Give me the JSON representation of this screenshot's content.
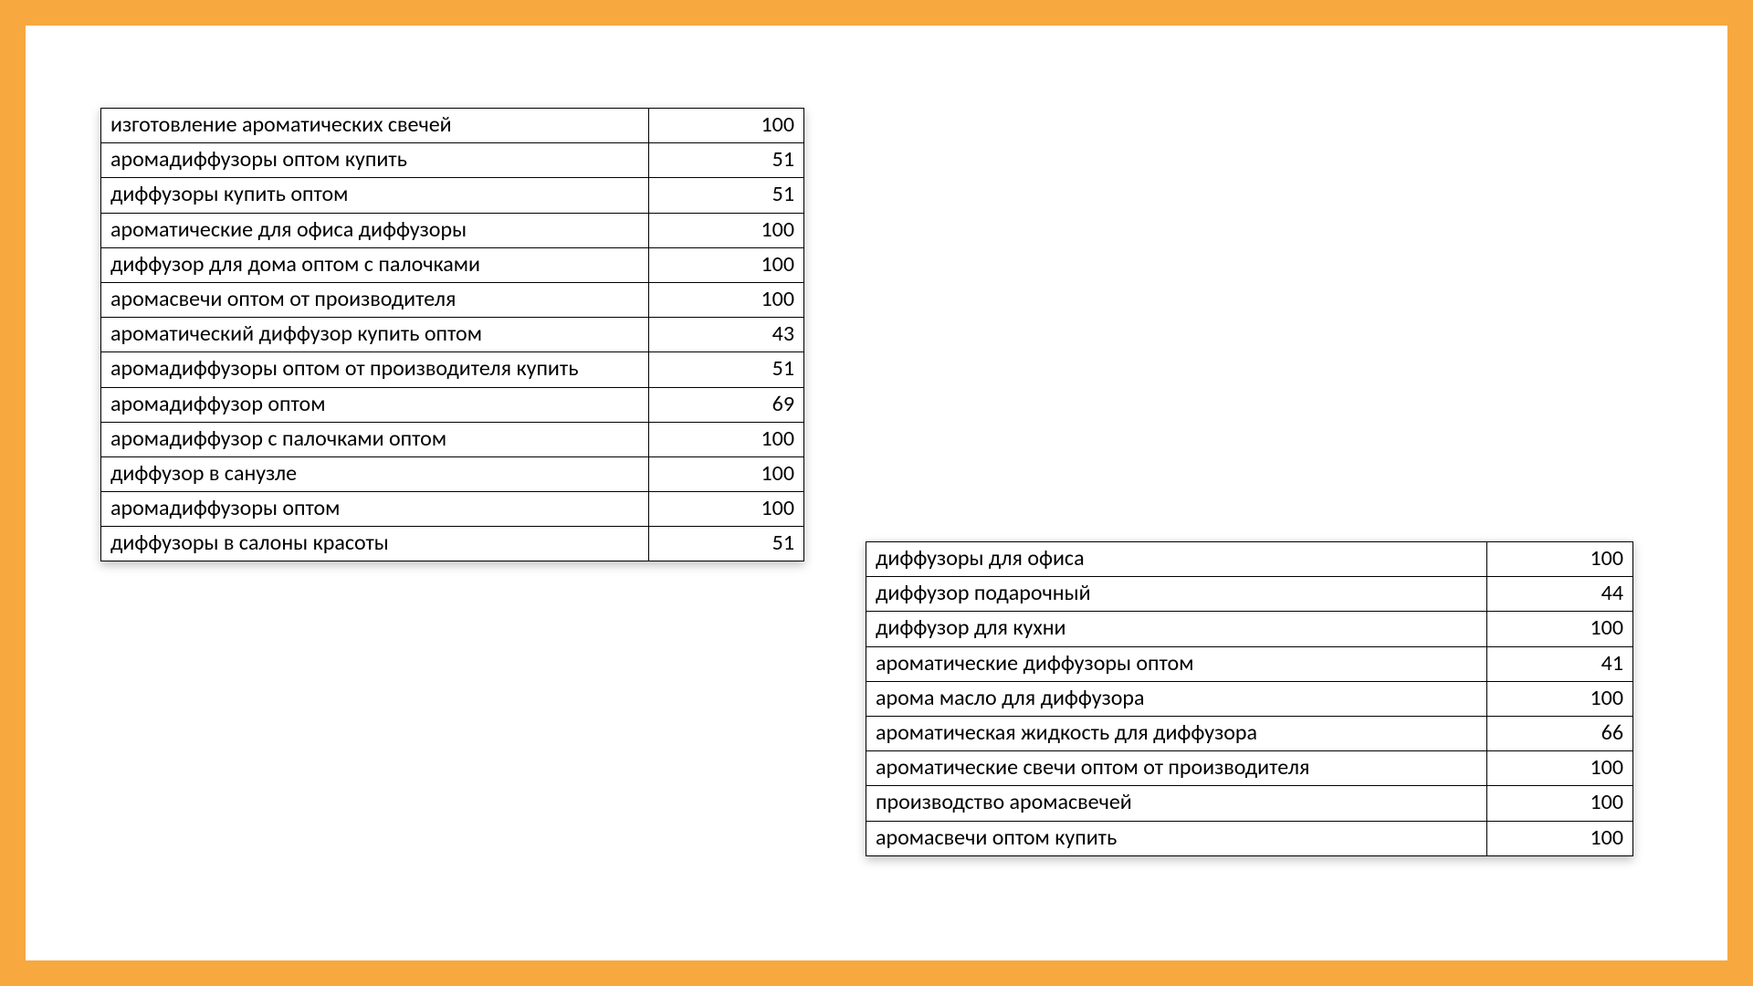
{
  "frame_color": "#f7a83f",
  "tables": {
    "left": {
      "rows": [
        {
          "term": "изготовление ароматических свечей",
          "value": 100
        },
        {
          "term": "аромадиффузоры оптом купить",
          "value": 51
        },
        {
          "term": "диффузоры купить оптом",
          "value": 51
        },
        {
          "term": "ароматические для офиса диффузоры",
          "value": 100
        },
        {
          "term": "диффузор для дома оптом с палочками",
          "value": 100
        },
        {
          "term": "аромасвечи оптом от производителя",
          "value": 100
        },
        {
          "term": "ароматический диффузор купить оптом",
          "value": 43
        },
        {
          "term": "аромадиффузоры оптом от производителя купить",
          "value": 51
        },
        {
          "term": "аромадиффузор оптом",
          "value": 69
        },
        {
          "term": "аромадиффузор с палочками оптом",
          "value": 100
        },
        {
          "term": "диффузор в санузле",
          "value": 100
        },
        {
          "term": "аромадиффузоры оптом",
          "value": 100
        },
        {
          "term": "диффузоры в салоны красоты",
          "value": 51
        }
      ]
    },
    "right": {
      "rows": [
        {
          "term": "диффузоры для офиса",
          "value": 100
        },
        {
          "term": "диффузор подарочный",
          "value": 44
        },
        {
          "term": "диффузор для кухни",
          "value": 100
        },
        {
          "term": "ароматические диффузоры оптом",
          "value": 41
        },
        {
          "term": "арома масло для диффузора",
          "value": 100
        },
        {
          "term": "ароматическая жидкость для диффузора",
          "value": 66
        },
        {
          "term": "ароматические свечи оптом от производителя",
          "value": 100
        },
        {
          "term": "производство аромасвечей",
          "value": 100
        },
        {
          "term": "аромасвечи оптом купить",
          "value": 100
        }
      ]
    }
  }
}
